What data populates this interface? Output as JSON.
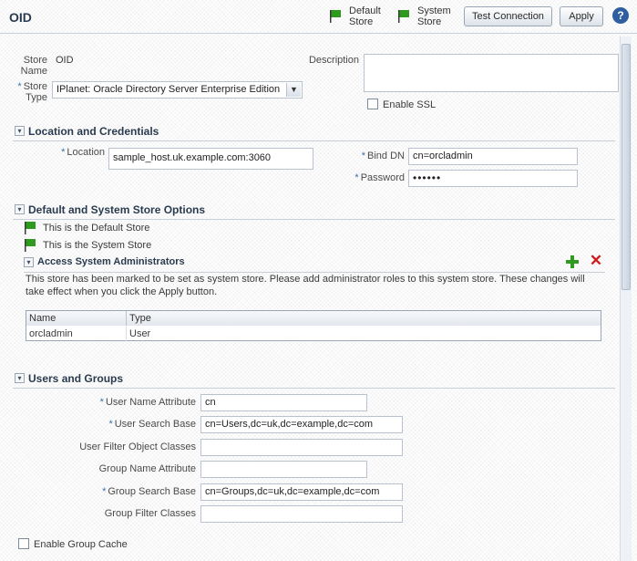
{
  "header": {
    "title": "OID",
    "default_store": {
      "line1": "Default",
      "line2": "Store"
    },
    "system_store": {
      "line1": "System",
      "line2": "Store"
    },
    "test_connection": "Test Connection",
    "apply": "Apply",
    "help": "?"
  },
  "store": {
    "name_label_1": "Store",
    "name_label_2": "Name",
    "name_value": "OID",
    "type_label_1": "Store",
    "type_label_2": "Type",
    "type_value": "IPlanet: Oracle Directory Server Enterprise Edition",
    "description_label": "Description",
    "description_value": "",
    "enable_ssl": "Enable SSL"
  },
  "location": {
    "title": "Location and Credentials",
    "location_label": "Location",
    "location_value": "sample_host.uk.example.com:3060",
    "bind_dn_label": "Bind DN",
    "bind_dn_value": "cn=orcladmin",
    "password_label": "Password",
    "password_value": "••••••"
  },
  "default_system": {
    "title": "Default and System Store Options",
    "default_msg": "This is the Default Store",
    "system_msg": "This is the System Store",
    "admins": {
      "title": "Access System Administrators",
      "message": "This store has been marked to be set as system store. Please add administrator roles to this system store. These changes will take effect when you click the Apply button.",
      "columns": [
        "Name",
        "Type"
      ],
      "rows": [
        {
          "name": "orcladmin",
          "type": "User"
        }
      ]
    }
  },
  "users_groups": {
    "title": "Users and Groups",
    "user_name_attr_label": "User Name Attribute",
    "user_name_attr_value": "cn",
    "user_search_base_label": "User Search Base",
    "user_search_base_value": "cn=Users,dc=uk,dc=example,dc=com",
    "user_filter_label": "User Filter Object Classes",
    "user_filter_value": "",
    "group_name_attr_label": "Group Name Attribute",
    "group_name_attr_value": "",
    "group_search_base_label": "Group Search Base",
    "group_search_base_value": "cn=Groups,dc=uk,dc=example,dc=com",
    "group_filter_label": "Group Filter Classes",
    "group_filter_value": "",
    "enable_group_cache": "Enable Group Cache"
  },
  "required_marker": "*",
  "colors": {
    "accent": "#3c6fa8",
    "flag_green": "#2f9a1f",
    "delete_red": "#d01a1a"
  }
}
